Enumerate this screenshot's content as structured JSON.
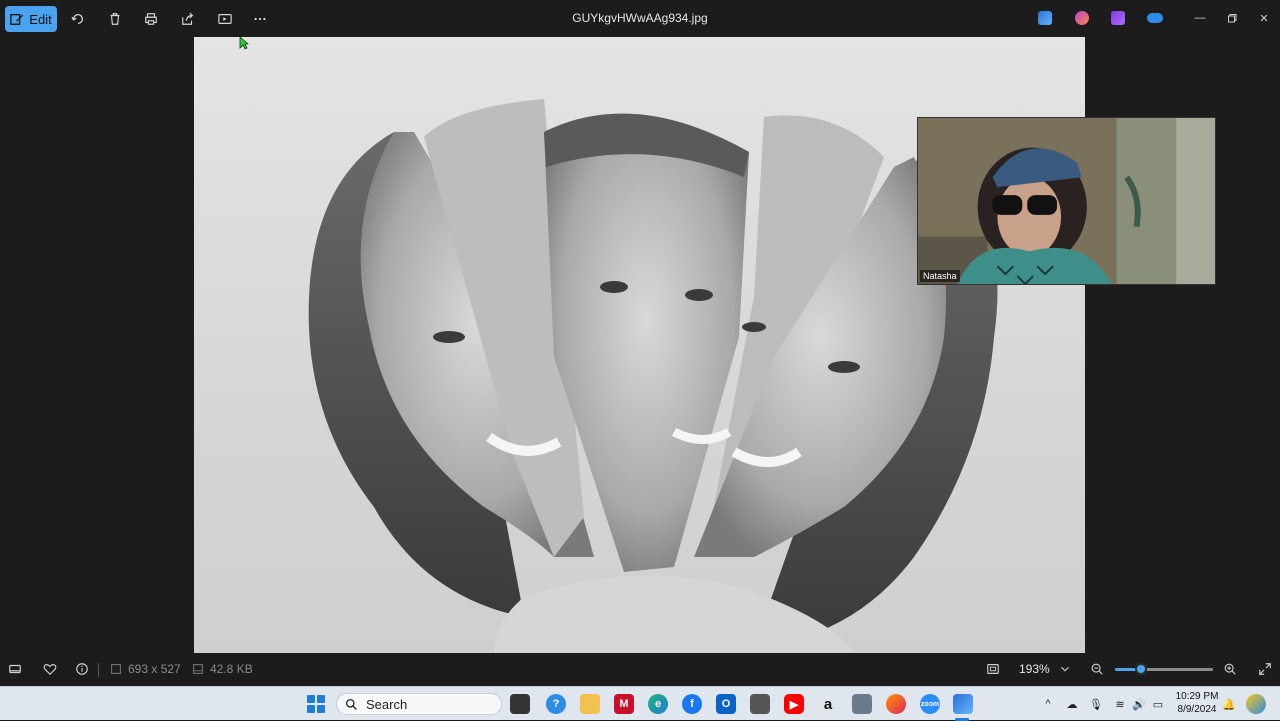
{
  "toolbar": {
    "edit_label": "Edit",
    "filename": "GUYkgvHWwAAg934.jpg",
    "icons": [
      "edit-icon",
      "rotate-icon",
      "delete-icon",
      "print-icon",
      "share-icon",
      "slideshow-icon",
      "more-icon"
    ]
  },
  "video_overlay": {
    "participant_name": "Natasha"
  },
  "statusbar": {
    "dimensions": "693 x 527",
    "file_size": "42.8 KB",
    "zoom": "193%",
    "zoom_fraction": 0.27
  },
  "taskbar": {
    "search_label": "Search",
    "time": "10:29 PM",
    "date": "8/9/2024"
  },
  "colors": {
    "accent": "#4aa3f0",
    "app_bg": "#1c1c1c",
    "taskbar_bg": "#dfe6ee"
  }
}
